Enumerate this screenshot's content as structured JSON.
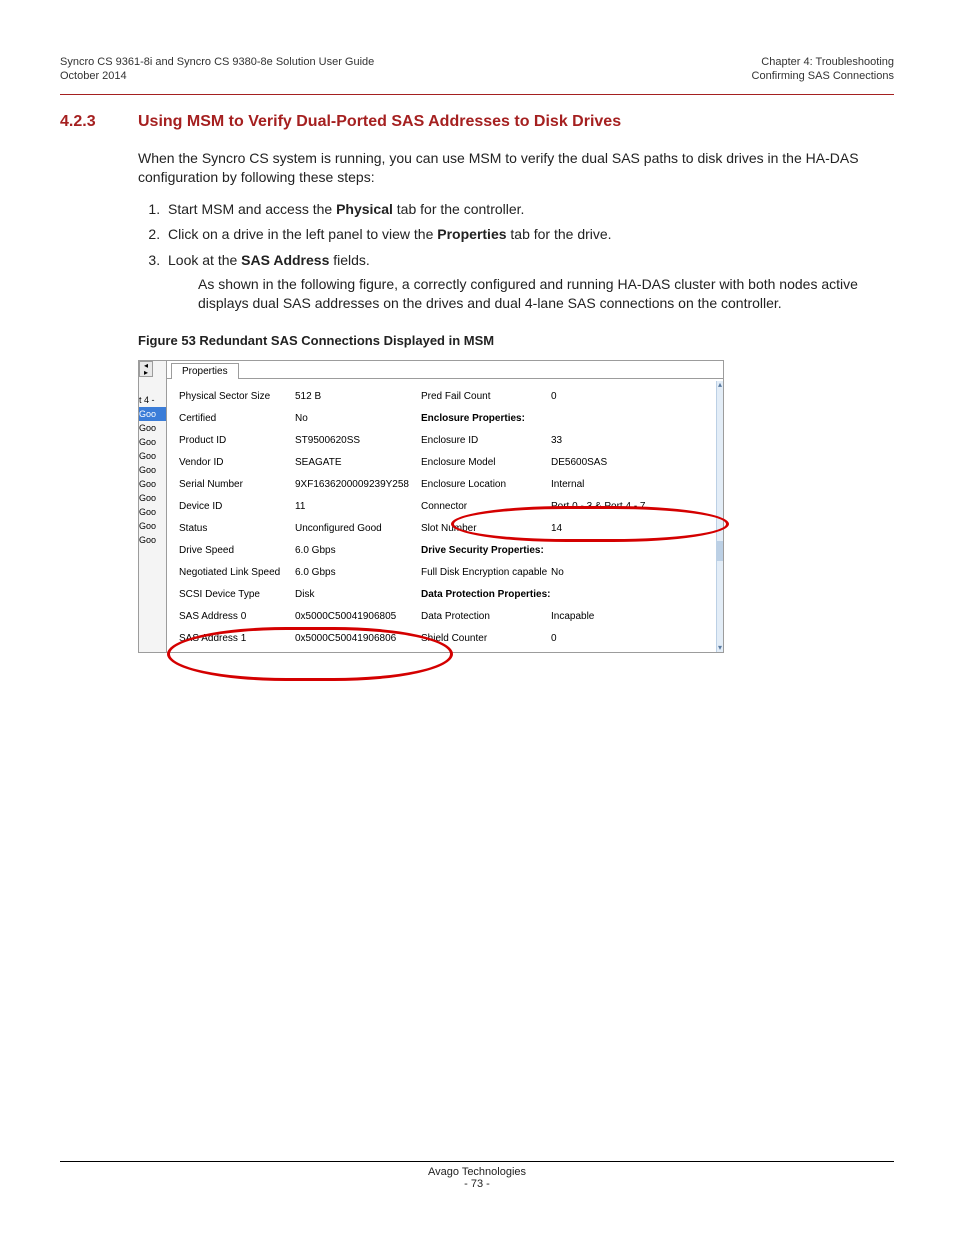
{
  "header": {
    "left1": "Syncro CS 9361-8i and Syncro CS 9380-8e Solution User Guide",
    "left2": "October 2014",
    "right1": "Chapter 4: Troubleshooting",
    "right2": "Confirming SAS Connections"
  },
  "section": {
    "num": "4.2.3",
    "title": "Using MSM to Verify Dual-Ported SAS Addresses to Disk Drives"
  },
  "intro": "When the Syncro CS system is running, you can use MSM to verify the dual SAS paths to disk drives in the HA-DAS configuration by following these steps:",
  "steps": {
    "s1a": "Start MSM and access the ",
    "s1b": "Physical",
    "s1c": " tab for the controller.",
    "s2a": "Click on a drive in the left panel to view the ",
    "s2b": "Properties",
    "s2c": " tab for the drive.",
    "s3a": "Look at the ",
    "s3b": "SAS Address",
    "s3c": " fields.",
    "note": "As shown in the following figure, a correctly configured and running HA-DAS cluster with both nodes active displays dual SAS addresses on the drives and dual 4-lane SAS connections on the controller."
  },
  "figure_caption": "Figure 53  Redundant SAS Connections Displayed in MSM",
  "msm": {
    "tab": "Properties",
    "tree": {
      "t0": "t 4 -",
      "g": "Goo"
    },
    "left": [
      {
        "l": "Physical Sector Size",
        "v": "512 B"
      },
      {
        "l": "Certified",
        "v": "No"
      },
      {
        "l": "Product ID",
        "v": "ST9500620SS"
      },
      {
        "l": "Vendor ID",
        "v": "SEAGATE"
      },
      {
        "l": "Serial Number",
        "v": "9XF1636200009239Y258"
      },
      {
        "l": "Device ID",
        "v": "11"
      },
      {
        "l": "Status",
        "v": "Unconfigured Good"
      },
      {
        "l": "Drive Speed",
        "v": "6.0 Gbps"
      },
      {
        "l": "Negotiated Link Speed",
        "v": "6.0 Gbps"
      },
      {
        "l": "SCSI Device Type",
        "v": "Disk"
      },
      {
        "l": "SAS Address 0",
        "v": "0x5000C50041906805"
      },
      {
        "l": "SAS Address 1",
        "v": "0x5000C50041906806"
      }
    ],
    "right": [
      {
        "l": "Pred Fail Count",
        "v": "0"
      },
      {
        "l": "Enclosure Properties:",
        "v": "",
        "h": true
      },
      {
        "l": "Enclosure ID",
        "v": "33"
      },
      {
        "l": "Enclosure Model",
        "v": "DE5600SAS"
      },
      {
        "l": "Enclosure Location",
        "v": "Internal"
      },
      {
        "l": "Connector",
        "v": "Port 0 - 3 & Port 4 - 7"
      },
      {
        "l": "Slot Number",
        "v": "14"
      },
      {
        "l": "Drive Security Properties:",
        "v": "",
        "h": true
      },
      {
        "l": "Full Disk Encryption capable",
        "v": "No"
      },
      {
        "l": "Data Protection Properties:",
        "v": "",
        "h": true
      },
      {
        "l": "Data Protection",
        "v": "Incapable"
      },
      {
        "l": "Shield Counter",
        "v": "0"
      }
    ]
  },
  "footer": {
    "company": "Avago Technologies",
    "page": "- 73 -"
  }
}
